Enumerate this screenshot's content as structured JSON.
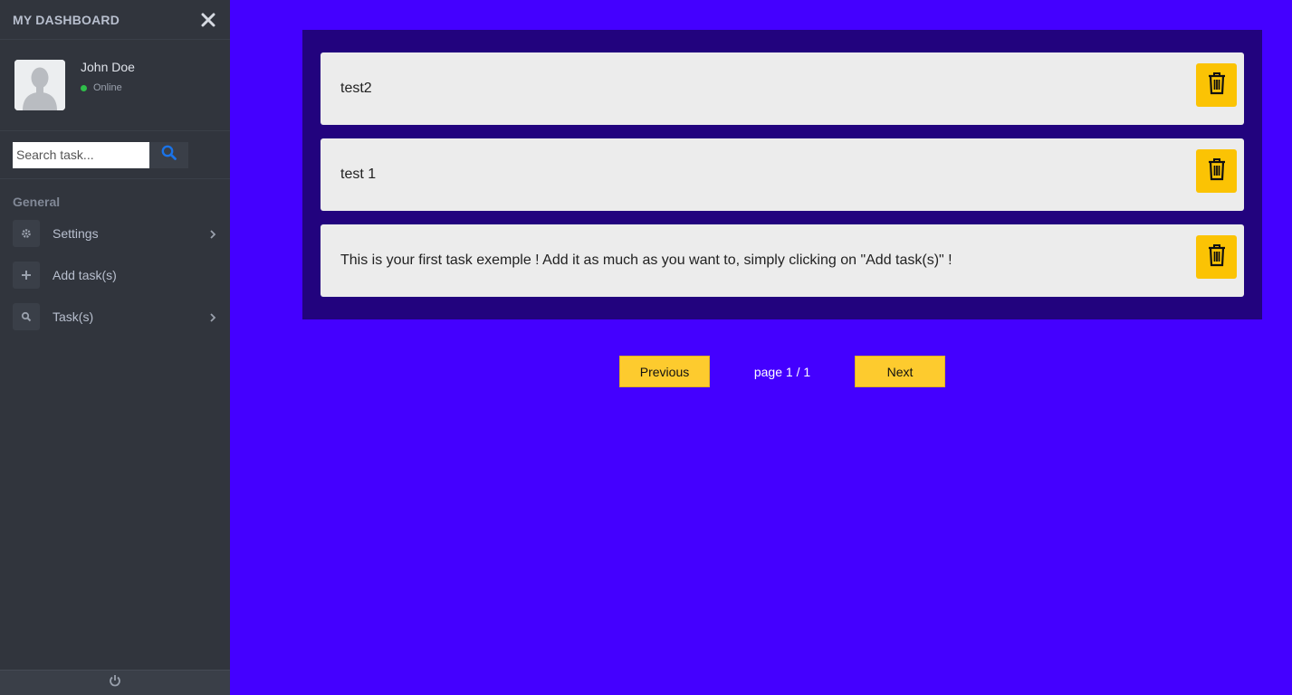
{
  "sidebar": {
    "title": "MY DASHBOARD",
    "close_icon": "close-icon",
    "profile": {
      "name": "John Doe",
      "status": "Online",
      "status_color": "#2fbf4a"
    },
    "search": {
      "placeholder": "Search task...",
      "value": "",
      "icon": "search-icon",
      "icon_color": "#1a73e8"
    },
    "menu": {
      "header": "General",
      "items": [
        {
          "label": "Settings",
          "icon": "gear-icon",
          "has_submenu": true
        },
        {
          "label": "Add task(s)",
          "icon": "plus-icon",
          "has_submenu": false
        },
        {
          "label": "Task(s)",
          "icon": "search-icon",
          "has_submenu": true
        }
      ]
    },
    "footer_icon": "power-icon"
  },
  "tasks": [
    {
      "text": "test2"
    },
    {
      "text": "test 1"
    },
    {
      "text": "This is your first task exemple ! Add it as much as you want to, simply clicking on \"Add task(s)\" !"
    }
  ],
  "pagination": {
    "previous_label": "Previous",
    "next_label": "Next",
    "page_text": "page 1 / 1"
  },
  "colors": {
    "background": "#4400ff",
    "panel": "#22037e",
    "sidebar": "#31353d",
    "accent": "#fbc304"
  }
}
